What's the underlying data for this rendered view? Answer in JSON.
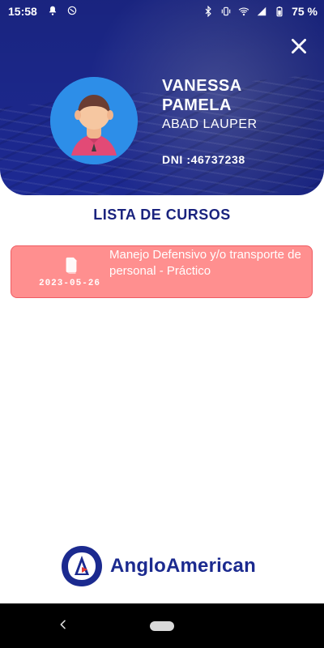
{
  "status_bar": {
    "time": "15:58",
    "battery": "75 %",
    "icons_left": [
      "notification-icon",
      "sync-icon"
    ],
    "icons_right": [
      "bluetooth-icon",
      "vibrate-icon",
      "wifi-icon",
      "signal-icon",
      "battery-icon"
    ]
  },
  "header": {
    "first_name": "VANESSA\nPAMELA",
    "last_name": "ABAD LAUPER",
    "dni": "DNI :46737238",
    "close_icon": "close-icon"
  },
  "courses": {
    "title": "LISTA DE CURSOS",
    "items": [
      {
        "date": "2023-05-26",
        "title": "Manejo Defensivo y/o transporte de personal - Práctico",
        "icon": "document-icon",
        "accent": "#ff8f8f"
      }
    ]
  },
  "brand": {
    "name": "AngloAmerican",
    "accent": "#1b2a8f"
  },
  "nav": {
    "back_icon": "back-icon",
    "home_icon": "home-pill-icon"
  }
}
